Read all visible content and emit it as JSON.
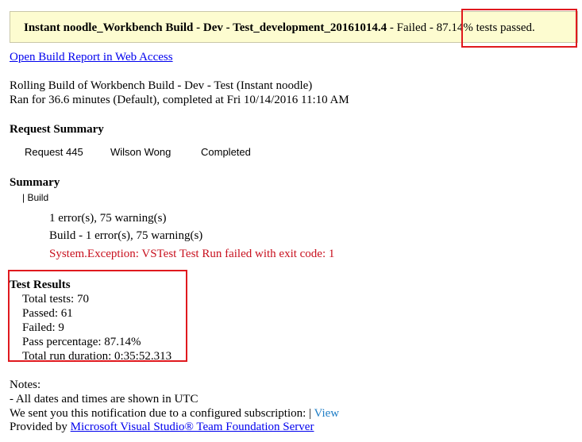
{
  "banner": {
    "title": "Instant noodle_Workbench Build - Dev - Test_development_20161014.4",
    "status": " - Failed - ",
    "result": "87.14% tests passed."
  },
  "report_link": "Open Build Report in Web Access",
  "build_info": {
    "line1": "Rolling Build of Workbench Build - Dev - Test (Instant noodle)",
    "line2": "Ran for 36.6 minutes (Default), completed at Fri 10/14/2016 11:10 AM"
  },
  "request_summary": {
    "heading": "Request Summary",
    "request": "Request 445",
    "user": "Wilson Wong",
    "state": "Completed"
  },
  "summary": {
    "heading": "Summary",
    "build_label": "| Build",
    "errors_total": "1 error(s), 75 warning(s)",
    "build_errors": "Build - 1 error(s), 75 warning(s)",
    "exception": "System.Exception: VSTest Test Run failed with exit code: 1"
  },
  "test_results": {
    "heading": "Test Results",
    "total": "Total tests: 70",
    "passed": "Passed: 61",
    "failed": "Failed: 9",
    "pass_percentage": "Pass percentage: 87.14%",
    "duration": "Total run duration: 0:35:52.313"
  },
  "notes": {
    "label": "Notes:",
    "utc": "- All dates and times are shown in UTC",
    "subscription": "We sent you this notification due to a configured subscription: | ",
    "view_link": "View",
    "provided_by": "Provided by ",
    "provider_link": "Microsoft Visual Studio® Team Foundation Server"
  },
  "colors": {
    "banner_bg": "#fdfcd0",
    "highlight": "#e0191e",
    "error": "#c8101e",
    "link": "#0000ee"
  }
}
